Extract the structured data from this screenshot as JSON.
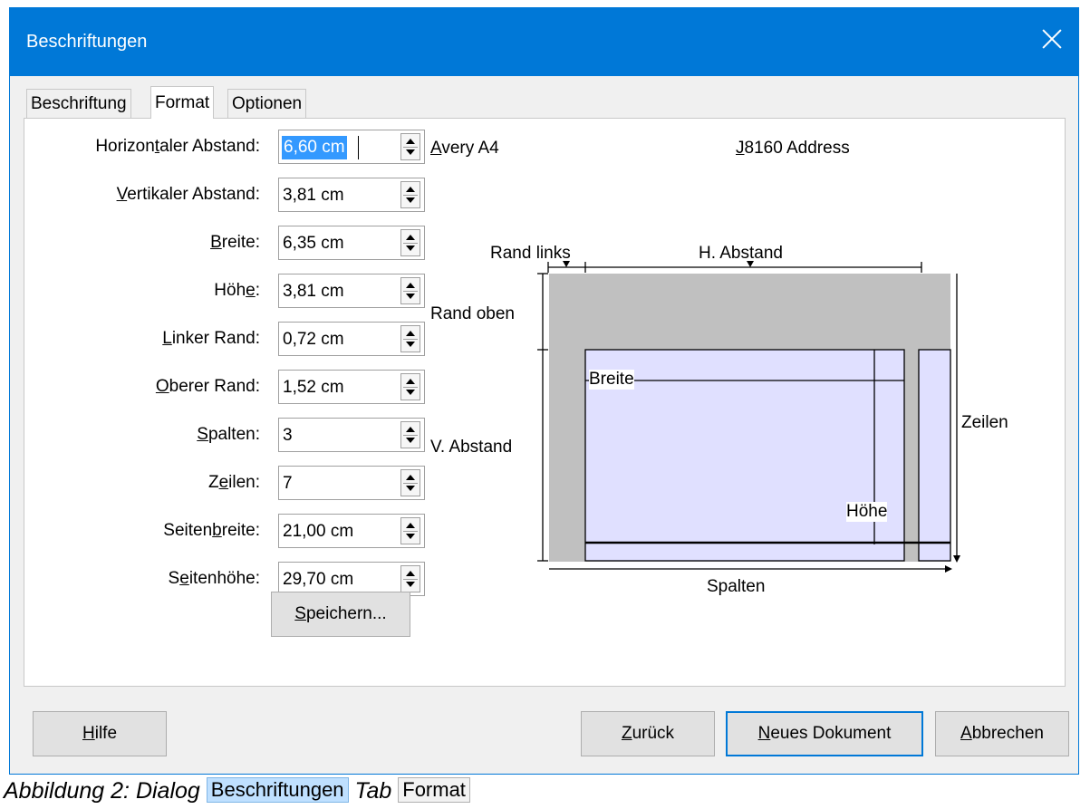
{
  "dialog": {
    "title": "Beschriftungen"
  },
  "tabs": [
    {
      "label": "Beschriftung",
      "active": false
    },
    {
      "label": "Format",
      "active": true
    },
    {
      "label": "Optionen",
      "active": false
    }
  ],
  "fields": [
    {
      "pre": "Horizon",
      "u": "t",
      "post": "aler Abstand:",
      "value": "6,60 cm",
      "selected": true
    },
    {
      "pre": "",
      "u": "V",
      "post": "ertikaler Abstand:",
      "value": "3,81 cm"
    },
    {
      "pre": "",
      "u": "B",
      "post": "reite:",
      "value": "6,35 cm"
    },
    {
      "pre": "Höh",
      "u": "e",
      "post": ":",
      "value": "3,81 cm"
    },
    {
      "pre": "",
      "u": "L",
      "post": "inker Rand:",
      "value": "0,72 cm"
    },
    {
      "pre": "",
      "u": "O",
      "post": "berer Rand:",
      "value": "1,52 cm"
    },
    {
      "pre": "",
      "u": "S",
      "post": "palten:",
      "value": "3"
    },
    {
      "pre": "Z",
      "u": "e",
      "post": "ilen:",
      "value": "7"
    },
    {
      "pre": "Seiten",
      "u": "b",
      "post": "reite:",
      "value": "21,00 cm"
    },
    {
      "pre": "S",
      "u": "e",
      "post": "itenhöhe:",
      "value": "29,70 cm"
    }
  ],
  "save_button": {
    "u": "S",
    "rest": "peichern..."
  },
  "brand": {
    "u": "A",
    "rest": "very A4"
  },
  "type": {
    "u": "J",
    "rest": "8160 Address"
  },
  "diagram": {
    "rand_links": "Rand links",
    "h_abstand": "H. Abstand",
    "rand_oben": "Rand oben",
    "breite": "Breite",
    "v_abstand": "V. Abstand",
    "zeilen": "Zeilen",
    "hoehe": "Höhe",
    "spalten": "Spalten"
  },
  "buttons": {
    "help": {
      "u": "H",
      "rest": "ilfe"
    },
    "back": {
      "u": "Z",
      "rest": "urück"
    },
    "new_doc": {
      "u": "N",
      "rest": "eues Dokument"
    },
    "cancel": {
      "u": "A",
      "rest": "bbrechen"
    }
  },
  "caption": {
    "prefix": "Abbildung 2: Dialog",
    "dialog_chip": "Beschriftungen",
    "middle": "Tab",
    "tab_chip": "Format"
  },
  "colors": {
    "accent": "#0078d7",
    "label_fill": "#e0e0ff",
    "margin_fill": "#c0c0c0"
  }
}
